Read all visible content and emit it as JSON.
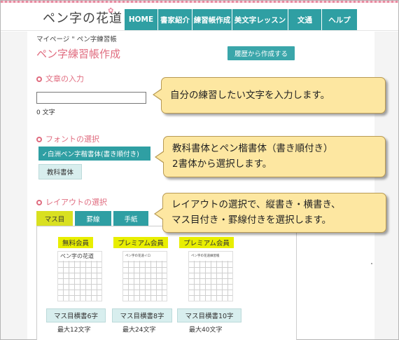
{
  "header": {
    "logo_text": "ペン字の花道",
    "nav": [
      "HOME",
      "書家紹介",
      "練習帳作成",
      "美文字レッスン",
      "文通",
      "ヘルプ"
    ]
  },
  "breadcrumb": "マイページ \" ペン字練習帳",
  "page_title": "ペン字練習帳作成",
  "history_button": "履歴から作成する",
  "text_section": {
    "heading": "文章の入力",
    "input_value": "",
    "char_count": "0 文字"
  },
  "font_section": {
    "heading": "フォントの選択",
    "options": [
      {
        "label": "✓白洲ペン字楷書体(書き順付き)",
        "selected": true
      },
      {
        "label": "教科書体",
        "selected": false
      }
    ]
  },
  "layout_section": {
    "heading": "レイアウトの選択",
    "tabs": [
      {
        "label": "マス目",
        "active": true
      },
      {
        "label": "罫線",
        "active": false
      },
      {
        "label": "手紙",
        "active": false
      }
    ],
    "cards": [
      {
        "tier": "無料会員",
        "sheet_header": "ペン字の花道",
        "button": "マス目横書6字",
        "max": "最大12文字"
      },
      {
        "tier": "プレミアム会員",
        "sheet_header": "ペン字の花道イロ",
        "button": "マス目横書8字",
        "max": "最大24文字"
      },
      {
        "tier": "プレミアム会員",
        "sheet_header": "ペン字の花道練習帳",
        "button": "マス目横書10字",
        "max": "最大40文字"
      }
    ]
  },
  "callouts": [
    {
      "lines": [
        "自分の練習したい文字を入力します。"
      ]
    },
    {
      "lines": [
        "教科書体とペン楷書体（書き順付き）",
        "2書体から選択します。"
      ]
    },
    {
      "lines": [
        "レイアウトの選択で、縦書き・横書き、",
        "マス目付き・罫線付きを選択します。"
      ]
    }
  ],
  "colors": {
    "teal": "#2f9fa3",
    "pink": "#e06d80",
    "callout_bg": "#fde7a1",
    "badge_yellow": "#e8ee00"
  }
}
